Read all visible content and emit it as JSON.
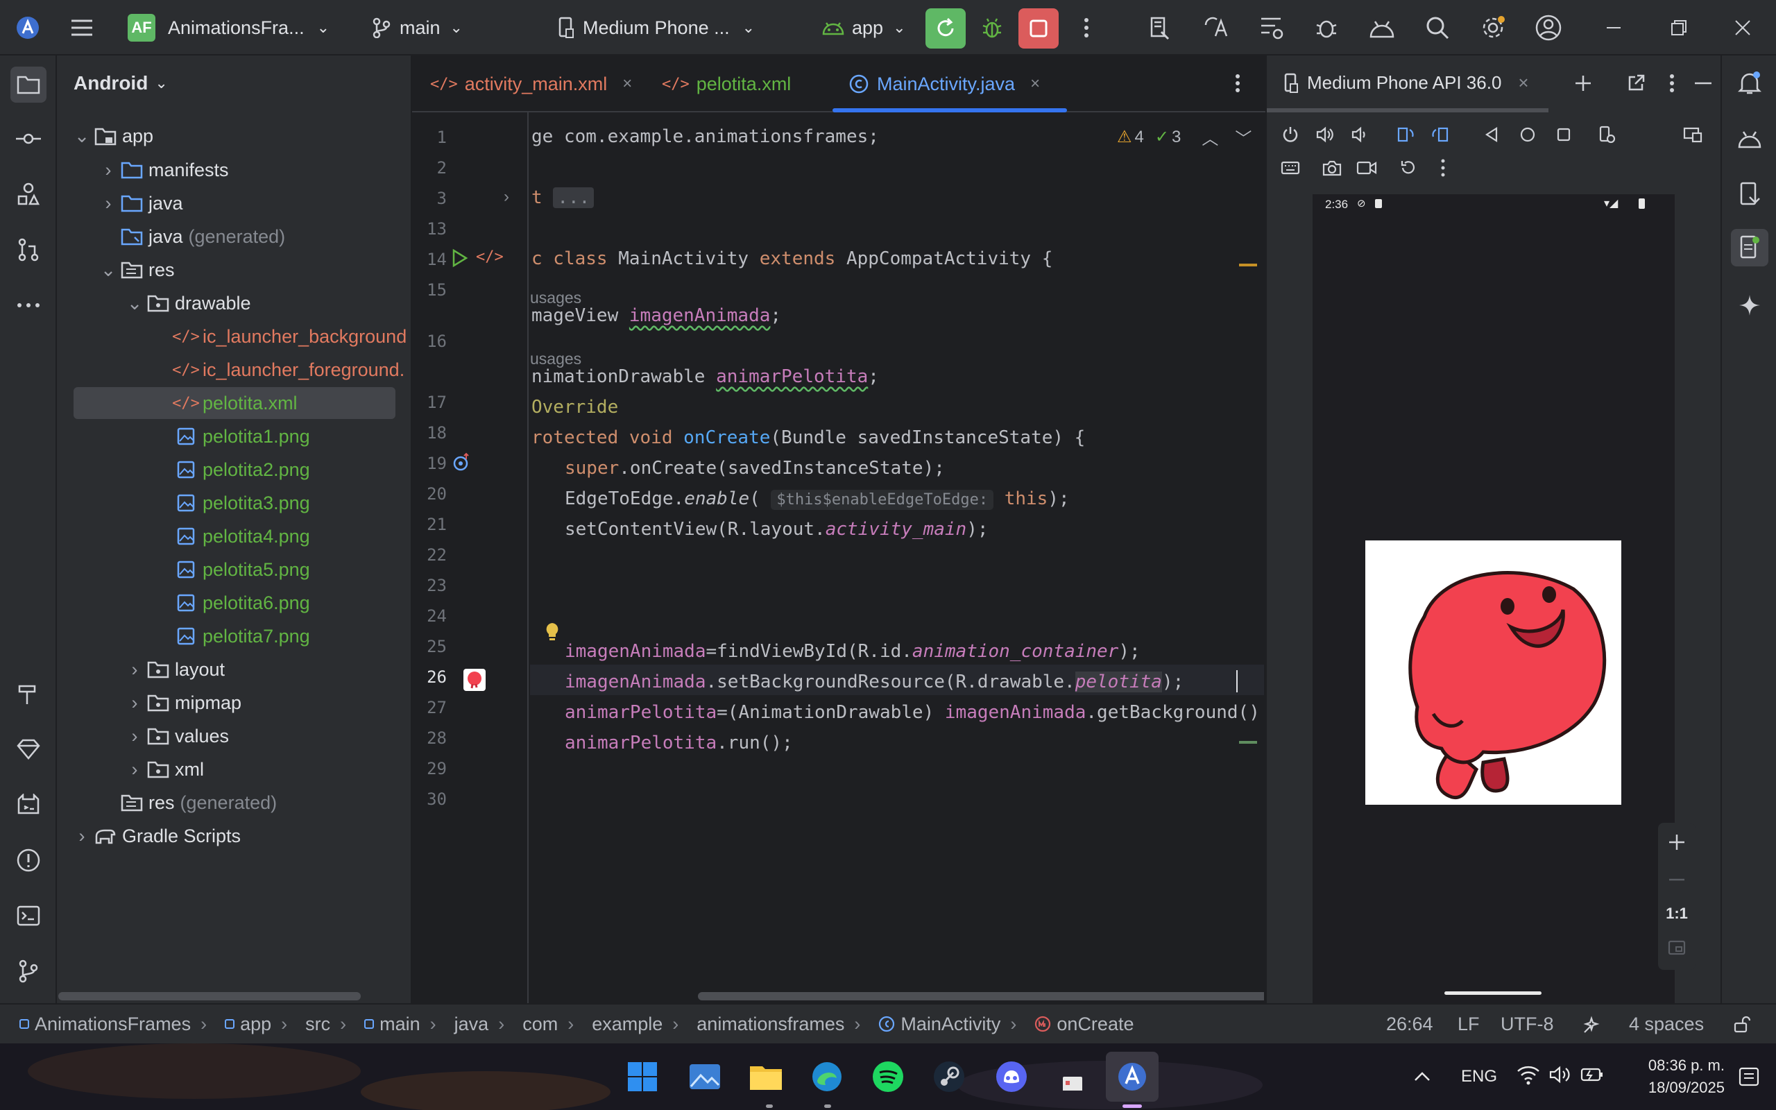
{
  "titlebar": {
    "project_badge": "AF",
    "project_name": "AnimationsFra...",
    "branch": "main",
    "device": "Medium Phone ...",
    "run_config": "app"
  },
  "project_panel": {
    "view_selector": "Android",
    "tree": [
      {
        "label": "app"
      },
      {
        "label": "manifests"
      },
      {
        "label": "java"
      },
      {
        "label": "java",
        "suffix": "(generated)"
      },
      {
        "label": "res"
      },
      {
        "label": "drawable"
      },
      {
        "label": "ic_launcher_background"
      },
      {
        "label": "ic_launcher_foreground."
      },
      {
        "label": "pelotita.xml"
      },
      {
        "label": "pelotita1.png"
      },
      {
        "label": "pelotita2.png"
      },
      {
        "label": "pelotita3.png"
      },
      {
        "label": "pelotita4.png"
      },
      {
        "label": "pelotita5.png"
      },
      {
        "label": "pelotita6.png"
      },
      {
        "label": "pelotita7.png"
      },
      {
        "label": "layout"
      },
      {
        "label": "mipmap"
      },
      {
        "label": "values"
      },
      {
        "label": "xml"
      },
      {
        "label": "res",
        "suffix": "(generated)"
      },
      {
        "label": "Gradle Scripts"
      }
    ]
  },
  "editor": {
    "tabs": [
      {
        "label": "activity_main.xml"
      },
      {
        "label": "pelotita.xml"
      },
      {
        "label": "MainActivity.java"
      }
    ],
    "tab_close": "×",
    "warnings": "4",
    "weak_warnings": "3",
    "line_numbers": [
      "1",
      "2",
      "3",
      "13",
      "14",
      "15",
      "16",
      "17",
      "18",
      "19",
      "20",
      "21",
      "22",
      "23",
      "24",
      "25",
      "26",
      "27",
      "28",
      "29",
      "30"
    ],
    "usages_label": "usages",
    "code": {
      "l1": "ge com.example.animationsframes;",
      "l3a": "t",
      "l3b": "...",
      "l14": [
        "c class ",
        "MainActivity ",
        "extends ",
        "AppCompatActivity {"
      ],
      "l16": [
        "mageView ",
        "imagenAnimada",
        ";"
      ],
      "l17": [
        "nimationDrawable ",
        "animarPelotita",
        ";"
      ],
      "l18": "Override",
      "l19": [
        "rotected void ",
        "onCreate",
        "(Bundle savedInstanceState) {"
      ],
      "l20": [
        "super",
        ".onCreate(savedInstanceState);"
      ],
      "l21": [
        "EdgeToEdge.",
        "enable",
        "(",
        "$this$enableEdgeToEdge:",
        "this",
        ");"
      ],
      "l22": [
        "setContentView(R.layout.",
        "activity_main",
        ");"
      ],
      "l25": [
        "imagenAnimada",
        "=findViewById(R.id.",
        "animation_container",
        ");"
      ],
      "l26": [
        "imagenAnimada",
        ".setBackgroundResource(R.drawable.",
        "pelotita",
        ");"
      ],
      "l27": [
        "animarPelotita",
        "=(AnimationDrawable) ",
        "imagenAnimada",
        ".getBackground()"
      ],
      "l28": [
        "animarPelotita",
        ".run();"
      ]
    }
  },
  "emulator": {
    "tab_label": "Medium Phone API 36.0",
    "status_time": "2:36",
    "zoom_label": "1:1"
  },
  "statusbar": {
    "breadcrumbs": [
      "AnimationsFrames",
      "app",
      "src",
      "main",
      "java",
      "com",
      "example",
      "animationsframes",
      "MainActivity",
      "onCreate"
    ],
    "position": "26:64",
    "line_ending": "LF",
    "encoding": "UTF-8",
    "indent": "4 spaces"
  },
  "taskbar": {
    "language": "ENG",
    "time": "08:36 p. m.",
    "date": "18/09/2025"
  },
  "colors": {
    "accent": "#3574f0",
    "ball": "#f2414f",
    "selection": "#43454a"
  }
}
